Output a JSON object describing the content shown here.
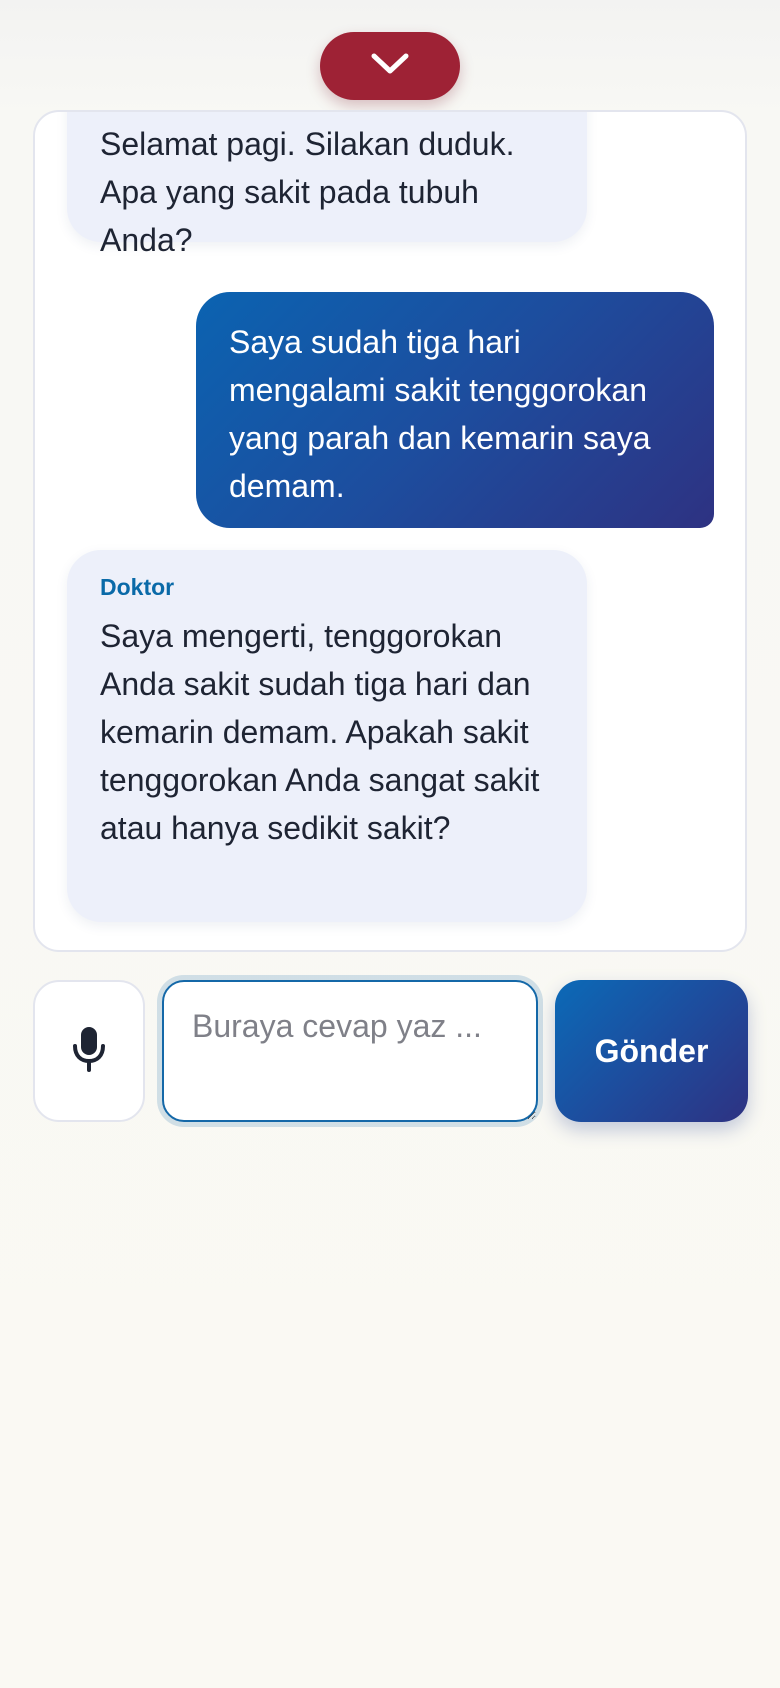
{
  "header": {
    "collapse_icon": "chevron-down-icon"
  },
  "messages": [
    {
      "role": "doctor",
      "sender": "",
      "text": "Selamat pagi. Silakan duduk. Apa yang sakit pada tubuh Anda?"
    },
    {
      "role": "patient",
      "text": "Saya sudah tiga hari mengalami sakit tenggorokan yang parah dan kemarin saya demam."
    },
    {
      "role": "doctor",
      "sender": "Doktor",
      "text": "Saya mengerti, tenggorokan Anda sakit sudah tiga hari dan kemarin demam. Apakah sakit tenggorokan Anda sangat sakit atau hanya sedikit sakit?"
    }
  ],
  "composer": {
    "mic_icon": "microphone-icon",
    "placeholder": "Buraya cevap yaz ...",
    "value": "",
    "send_label": "Gönder"
  },
  "colors": {
    "accent_red": "#9e2235",
    "accent_blue": "#1d4d9e",
    "doctor_bubble": "#edf0fa",
    "sender_label": "#0a6aa8"
  }
}
